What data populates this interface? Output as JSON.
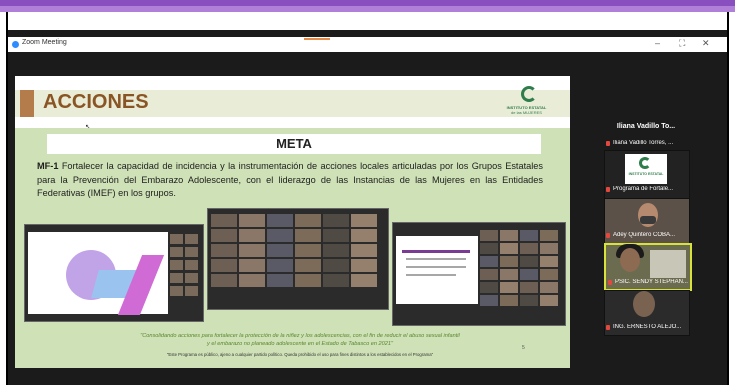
{
  "window": {
    "title": "Zoom Meeting",
    "controls": [
      "–",
      "⛶",
      "✕"
    ]
  },
  "slide": {
    "title": "ACCIONES",
    "logo_line1": "INSTITUTO ESTATAL",
    "logo_line2": "de las MUJERES",
    "meta_heading": "META",
    "meta_code": "MF-1",
    "meta_text": " Fortalecer la capacidad de incidencia y la instrumentación de acciones locales articuladas por los Grupos Estatales para la Prevención del Embarazo Adolescente, con el liderazgo de las Instancias de las Mujeres en las Entidades Federativas (IMEF) en los grupos.",
    "quote_line1": "\"Consolidando acciones para fortalecer la protección de la niñez y los adolescencias, con el fin de reducir el abuso sexual infantil",
    "quote_line2": "y el embarazo no planeado adolescente en el Estado de Tabasco en 2021\"",
    "page_number": "5",
    "footnote": "\"Este Programa es público, ajeno a cualquier partido político. Queda prohibido el uso para fines distintos a los establecidos en el Programa\""
  },
  "participants": [
    {
      "big_name": "Iliana Vadillo To...",
      "name": "Iliana Vadillo Torres, ..."
    },
    {
      "name": "Programa de Fortale..."
    },
    {
      "name": "Adey Quintero COBA..."
    },
    {
      "name": "PSIC. SENDY STEPHAN..."
    },
    {
      "name": "ING. ERNESTO ALEJO..."
    }
  ],
  "colors": {
    "accent_purple": "#8a4fbf",
    "slide_green": "#cfe1b6",
    "title_brown": "#8a5524",
    "active_speaker": "#d7e33a"
  }
}
